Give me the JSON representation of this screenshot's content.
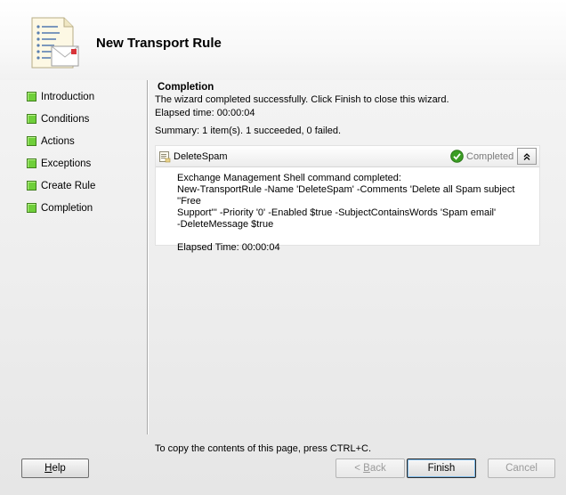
{
  "header": {
    "title": "New Transport Rule"
  },
  "nav": {
    "items": [
      {
        "label": "Introduction"
      },
      {
        "label": "Conditions"
      },
      {
        "label": "Actions"
      },
      {
        "label": "Exceptions"
      },
      {
        "label": "Create Rule"
      },
      {
        "label": "Completion"
      }
    ]
  },
  "main": {
    "section_title": "Completion",
    "message": "The wizard completed successfully. Click Finish to close this wizard.",
    "elapsed": "Elapsed time: 00:00:04",
    "summary": "Summary: 1 item(s). 1 succeeded, 0 failed."
  },
  "result": {
    "task_name": "DeleteSpam",
    "status": "Completed",
    "status_color": "#3a9d23",
    "line1": "Exchange Management Shell command completed:",
    "line2": "New-TransportRule -Name 'DeleteSpam' -Comments 'Delete all Spam subject ''Free",
    "line3": "Support''' -Priority '0' -Enabled $true -SubjectContainsWords 'Spam email'",
    "line4": "-DeleteMessage $true",
    "elapsed": "Elapsed Time: 00:00:04"
  },
  "footer": {
    "copy_hint": "To copy the contents of this page, press CTRL+C.",
    "help_first": "H",
    "help_rest": "elp",
    "back_prefix": "< ",
    "back_first": "B",
    "back_rest": "ack",
    "finish_label": "Finish",
    "cancel_label": "Cancel"
  }
}
